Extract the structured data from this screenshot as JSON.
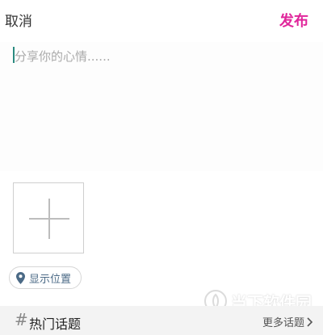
{
  "header": {
    "cancel_label": "取消",
    "publish_label": "发布"
  },
  "compose": {
    "placeholder": "分享你的心情......",
    "value": ""
  },
  "media": {
    "add_icon": "plus-icon"
  },
  "location": {
    "label": "显示位置",
    "icon": "location-pin-icon"
  },
  "topics": {
    "hash_symbol": "#",
    "title": "热门话题",
    "more_label": "更多话题",
    "more_icon": "chevron-right-icon"
  },
  "watermark": {
    "text": "当下软件园"
  },
  "colors": {
    "accent": "#e0269b",
    "caret": "#2a8a80",
    "location_text": "#4b6a86"
  }
}
